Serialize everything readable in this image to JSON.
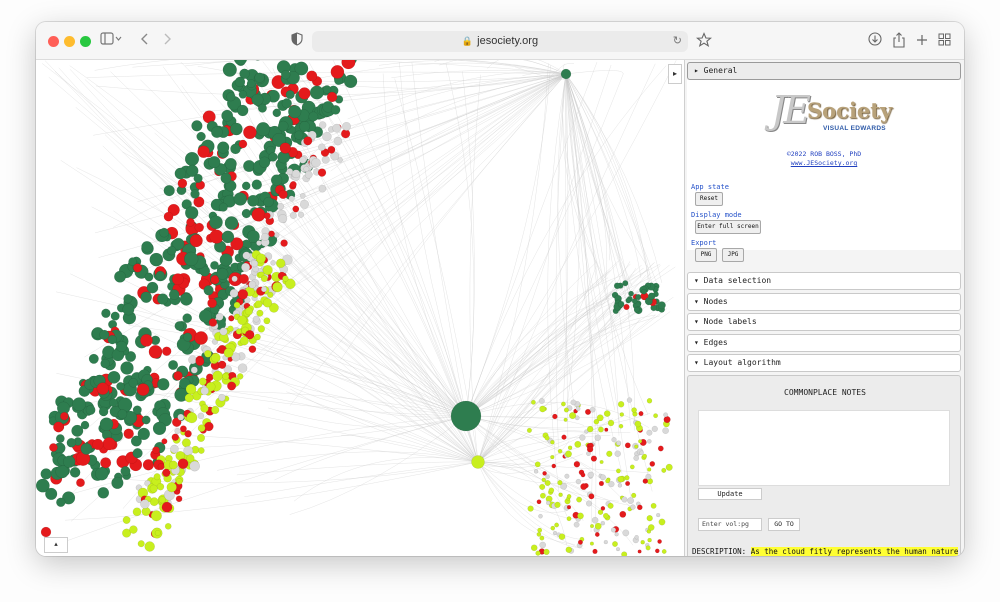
{
  "browser": {
    "url": "jesociety.org",
    "icons": {
      "sidebar": "sidebar-toggle-icon",
      "back": "chevron-left-icon",
      "forward": "chevron-right-icon",
      "shield": "shield-icon",
      "lock": "lock-icon",
      "reload": "reload-icon",
      "bookmark": "star-icon",
      "download": "download-icon",
      "share": "share-icon",
      "new_tab": "plus-icon",
      "tabs": "tab-overview-icon"
    }
  },
  "graph": {
    "collapse_glyph": "▸",
    "minimap_glyph": "▴",
    "colors": {
      "dark_green": "#2e7d4f",
      "red": "#e41a1c",
      "lime": "#c8ef1e",
      "gray": "#d9d9d9",
      "edges": "#9a9a9a"
    }
  },
  "panel": {
    "sections": {
      "general": "General",
      "data_selection": "Data selection",
      "nodes": "Nodes",
      "node_labels": "Node labels",
      "edges": "Edges",
      "layout_algorithm": "Layout algorithm"
    },
    "expanded_glyph": "▸",
    "collapsed_glyph": "▾",
    "logo": {
      "je": "JE",
      "society": "Society",
      "subtitle": "VISUAL EDWARDS"
    },
    "credit": "©2022 ROB BOSS, PhD",
    "site_link": "www.JESociety.org",
    "app_state_label": "App state",
    "reset_label": "Reset",
    "display_mode_label": "Display mode",
    "fullscreen_label": "Enter full screen",
    "export_label": "Export",
    "png_label": "PNG",
    "jpg_label": "JPG"
  },
  "notes": {
    "title": "COMMONPLACE NOTES",
    "update_label": "Update",
    "vol_placeholder": "Enter vol:pg",
    "goto_label": "GO TO",
    "description_label": "DESCRIPTION:",
    "description_text": "As the cloud fitly represents the human nature of Christ's person, so also it doth of Christ mystical, or the human nature of the church. In the"
  }
}
